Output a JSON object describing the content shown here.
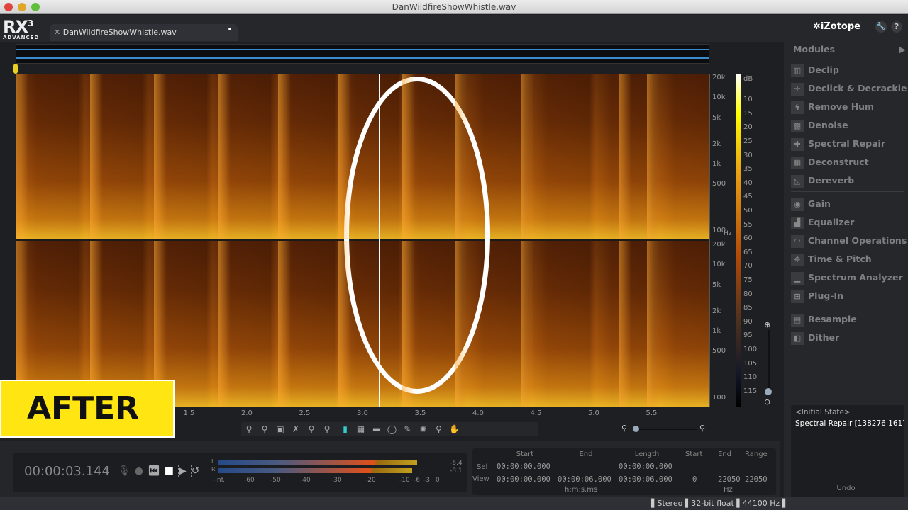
{
  "window": {
    "title": "DanWildfireShowWhistle.wav"
  },
  "app": {
    "logo": "RX",
    "logo_sup": "3",
    "edition": "ADVANCED",
    "brand": "iZotope"
  },
  "tab": {
    "label": "DanWildfireShowWhistle.wav"
  },
  "freq_labels": [
    "20k",
    "10k",
    "5k",
    "2k",
    "1k",
    "500",
    "100"
  ],
  "freq_unit": "Hz",
  "db_labels": [
    "dB",
    "10",
    "15",
    "20",
    "25",
    "30",
    "35",
    "40",
    "45",
    "50",
    "55",
    "60",
    "65",
    "70",
    "75",
    "80",
    "85",
    "90",
    "95",
    "100",
    "105",
    "110",
    "115"
  ],
  "time_labels": [
    "1.5",
    "2.0",
    "2.5",
    "3.0",
    "3.5",
    "4.0",
    "4.5",
    "5.0",
    "5.5"
  ],
  "overlay": {
    "badge": "AFTER",
    "accent": "#ffe512"
  },
  "transport": {
    "time": "00:00:03.144"
  },
  "meter": {
    "L": "L",
    "R": "R",
    "L_peak": "-6.4",
    "R_peak": "-8.1",
    "scale": [
      "-Inf.",
      "-60",
      "-50",
      "-40",
      "-30",
      "-20",
      "-10",
      "-6",
      "-3",
      "0"
    ],
    "L_level_db": -6.4,
    "R_level_db": -8.1
  },
  "selection": {
    "headers": [
      "Start",
      "End",
      "Length"
    ],
    "sel_label": "Sel",
    "view_label": "View",
    "sel": [
      "00:00:00.000",
      "",
      "00:00:00.000"
    ],
    "view": [
      "00:00:00.000",
      "00:00:06.000",
      "00:00:06.000"
    ],
    "unit": "h:m:s.ms",
    "freq_headers": [
      "Start",
      "End",
      "Range"
    ],
    "freq_sel": [
      "",
      "",
      ""
    ],
    "freq_view": [
      "0",
      "22050",
      "22050"
    ],
    "freq_unit": "Hz"
  },
  "modules": {
    "title": "Modules",
    "groups": [
      [
        "Declip",
        "Declick & Decrackle",
        "Remove Hum",
        "Denoise",
        "Spectral Repair",
        "Deconstruct",
        "Dereverb"
      ],
      [
        "Gain",
        "Equalizer",
        "Channel Operations",
        "Time & Pitch",
        "Spectrum Analyzer",
        "Plug-In"
      ],
      [
        "Resample",
        "Dither"
      ]
    ]
  },
  "undo": {
    "items": [
      "<Initial State>",
      "Spectral Repair [138276 1617"
    ],
    "label": "Undo"
  },
  "status": {
    "channels": "Stereo",
    "bit_depth": "32-bit float",
    "sample_rate": "44100 Hz"
  }
}
